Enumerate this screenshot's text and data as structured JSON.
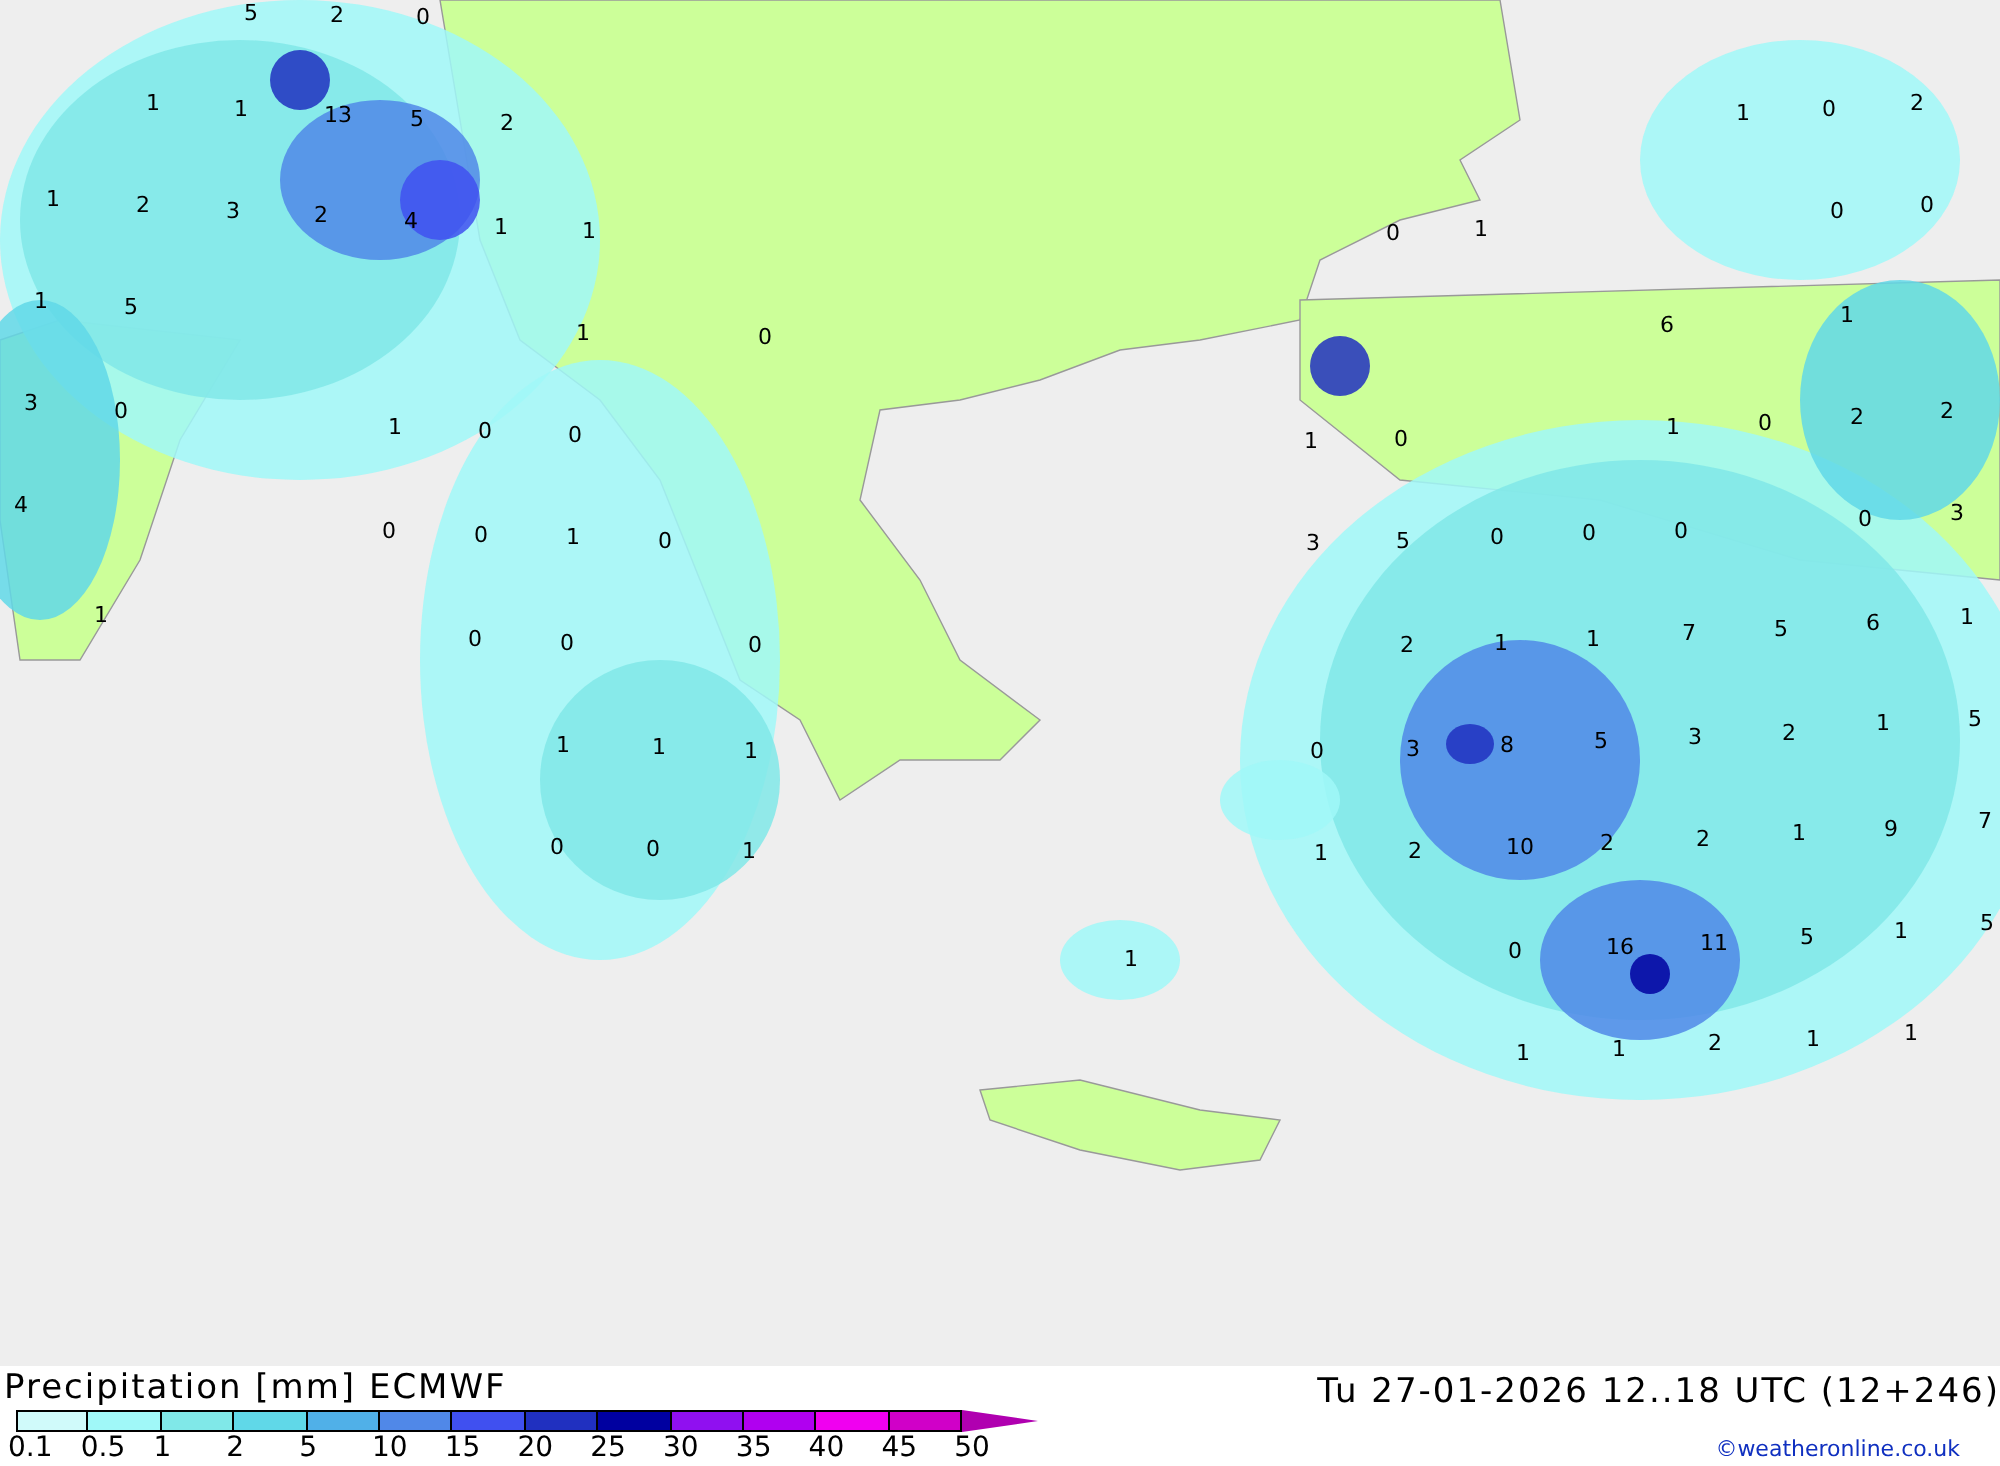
{
  "map_labels": [
    "5",
    "2",
    "0",
    "1",
    "1",
    "13",
    "5",
    "2",
    "1",
    "2",
    "3",
    "2",
    "4",
    "1",
    "1",
    "1",
    "5",
    "1",
    "0",
    "3",
    "0",
    "1",
    "0",
    "0",
    "4",
    "0",
    "0",
    "1",
    "0",
    "1",
    "0",
    "0",
    "0",
    "1",
    "1",
    "1",
    "0",
    "0",
    "1",
    "1",
    "1",
    "0",
    "2",
    "0",
    "0",
    "0",
    "1",
    "6",
    "1",
    "1",
    "0",
    "1",
    "0",
    "2",
    "2",
    "0",
    "3",
    "3",
    "5",
    "0",
    "0",
    "0",
    "2",
    "1",
    "1",
    "7",
    "5",
    "6",
    "1",
    "0",
    "3",
    "8",
    "5",
    "3",
    "2",
    "1",
    "5",
    "1",
    "2",
    "10",
    "2",
    "2",
    "1",
    "9",
    "7",
    "0",
    "16",
    "11",
    "5",
    "1",
    "5",
    "1",
    "1",
    "2",
    "1",
    "1"
  ],
  "footer": {
    "title": "Precipitation [mm] ECMWF",
    "datetime": "Tu 27-01-2026 12..18 UTC (12+246)",
    "credit": "©weatheronline.co.uk"
  },
  "scale": [
    {
      "label": "0.1",
      "color": "#d0fafa"
    },
    {
      "label": "0.5",
      "color": "#a0f8f8"
    },
    {
      "label": "1",
      "color": "#80e8e8"
    },
    {
      "label": "2",
      "color": "#60d8e8"
    },
    {
      "label": "5",
      "color": "#50b0e8"
    },
    {
      "label": "10",
      "color": "#5088e8"
    },
    {
      "label": "15",
      "color": "#4050f0"
    },
    {
      "label": "20",
      "color": "#2030c0"
    },
    {
      "label": "25",
      "color": "#0000a0"
    },
    {
      "label": "30",
      "color": "#9010f0"
    },
    {
      "label": "35",
      "color": "#b000f0"
    },
    {
      "label": "40",
      "color": "#f000f0"
    },
    {
      "label": "45",
      "color": "#d000c8"
    },
    {
      "label": "50",
      "color": "#b000b0"
    }
  ]
}
